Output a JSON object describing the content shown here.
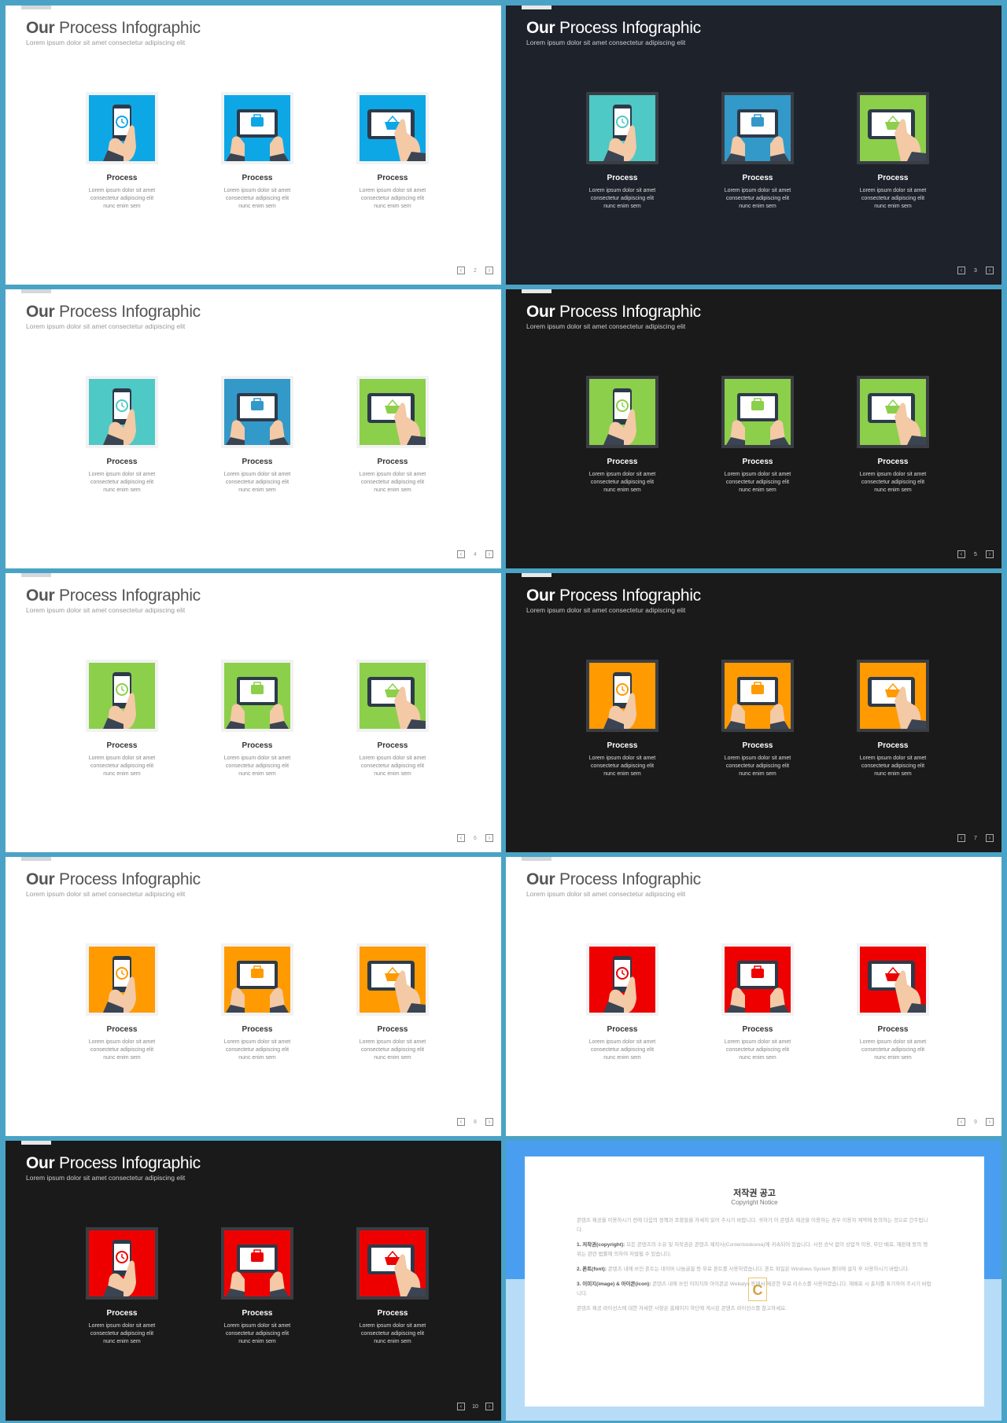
{
  "title_bold": "Our",
  "title_rest": "Process Infographic",
  "subtitle": "Lorem ipsum dolor sit amet consectetur adipiscing elit",
  "item_label": "Process",
  "item_desc": "Lorem ipsum dolor sit amet consectetur adipiscing elit nunc enim sem",
  "colors": {
    "blue": "#0ea7e6",
    "teal": "#4ec9c5",
    "steel": "#3399c9",
    "green": "#8ccf4a",
    "orange": "#ff9a00",
    "red": "#ee0000"
  },
  "slides": [
    {
      "page": "2",
      "theme": "white",
      "tiles": [
        "#0ea7e6",
        "#0ea7e6",
        "#0ea7e6"
      ]
    },
    {
      "page": "3",
      "theme": "navy",
      "tiles": [
        "#4ec9c5",
        "#3399c9",
        "#8ccf4a"
      ]
    },
    {
      "page": "4",
      "theme": "white",
      "tiles": [
        "#4ec9c5",
        "#3399c9",
        "#8ccf4a"
      ]
    },
    {
      "page": "5",
      "theme": "black",
      "tiles": [
        "#8ccf4a",
        "#8ccf4a",
        "#8ccf4a"
      ]
    },
    {
      "page": "6",
      "theme": "white",
      "tiles": [
        "#8ccf4a",
        "#8ccf4a",
        "#8ccf4a"
      ]
    },
    {
      "page": "7",
      "theme": "black",
      "tiles": [
        "#ff9a00",
        "#ff9a00",
        "#ff9a00"
      ]
    },
    {
      "page": "8",
      "theme": "white",
      "tiles": [
        "#ff9a00",
        "#ff9a00",
        "#ff9a00"
      ]
    },
    {
      "page": "9",
      "theme": "white",
      "tiles": [
        "#ee0000",
        "#ee0000",
        "#ee0000"
      ]
    },
    {
      "page": "10",
      "theme": "black",
      "tiles": [
        "#ee0000",
        "#ee0000",
        "#ee0000"
      ]
    }
  ],
  "copyright": {
    "title": "저작권 공고",
    "subtitle": "Copyright Notice",
    "intro": "콘텐츠 제공을 이용하시기 전에 다음의 정책과 조항들을 자세히 읽어 주시기 바랍니다. 귀하가 이 콘텐츠 제공을 이용하는 경우 이용자 계약에 동의하는 것으로 간주됩니다.",
    "s1_head": "1. 저작권(copyright):",
    "s1_body": "모든 콘텐츠의 소유 및 저작권은 콘텐츠 제작사(Contentstokorea)에 귀속되어 있습니다. 사전 승낙 없이 상업적 이용, 무단 배포, 재판매 등의 행위는 관련 법률에 의하여 처벌될 수 있습니다.",
    "s2_head": "2. 폰트(font):",
    "s2_body": "콘텐츠 내에 쓰인 폰트는 네이버 나눔글꼴 등 무료 폰트를 사용하였습니다. 폰트 파일은 Windows System 폴더에 설치 후 사용하시기 바랍니다.",
    "s3_head": "3. 이미지(image) & 아이콘(icon):",
    "s3_body": "콘텐츠 내에 쓰인 이미지와 아이콘은 Webalys 등에서 제공한 무료 리소스를 사용하였습니다. 재배포 시 출처를 표기하여 주시기 바랍니다.",
    "outro": "콘텐츠 제공 라이선스에 대한 자세한 사항은 홈페이지 하단에 게시된 콘텐츠 라이선스를 참고하세요.",
    "logo": "C"
  }
}
